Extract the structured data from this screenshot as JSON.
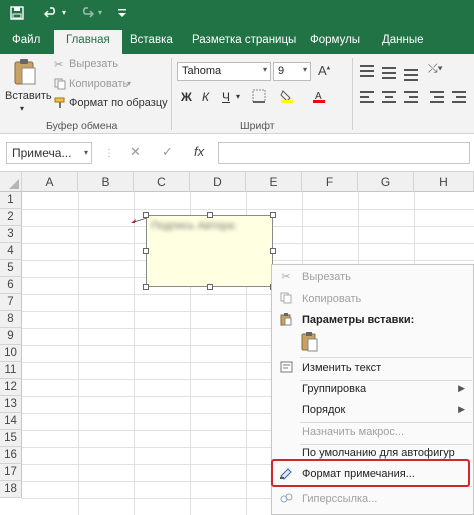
{
  "ribbon_tabs": [
    "Файл",
    "Главная",
    "Вставка",
    "Разметка страницы",
    "Формулы",
    "Данные"
  ],
  "active_tab": "Главная",
  "clipboard": {
    "paste": "Вставить",
    "cut": "Вырезать",
    "copy": "Копировать",
    "format_painter": "Формат по образцу",
    "group_label": "Буфер обмена"
  },
  "font": {
    "name": "Tahoma",
    "size": "9",
    "bold": "Ж",
    "italic": "К",
    "underline": "Ч",
    "group_label": "Шрифт"
  },
  "formula_bar": {
    "name_box": "Примеча...",
    "cancel": "✕",
    "enter": "✓",
    "fx": "fx"
  },
  "columns": [
    "A",
    "B",
    "C",
    "D",
    "E",
    "F",
    "G",
    "H"
  ],
  "rows": [
    "1",
    "2",
    "3",
    "4",
    "5",
    "6",
    "7",
    "8",
    "9",
    "10",
    "11",
    "12",
    "13",
    "14",
    "15",
    "16",
    "17",
    "18"
  ],
  "comment": {
    "text": "Подпись Автора:",
    "background": "#ffffe1"
  },
  "context_menu": [
    {
      "label": "Вырезать",
      "icon": "scissors-icon",
      "disabled": true
    },
    {
      "label": "Копировать",
      "icon": "copy-icon",
      "disabled": true
    },
    {
      "label": "Параметры вставки:",
      "icon": "paste-icon",
      "disabled": false,
      "bold": true
    },
    {
      "label": "Изменить текст",
      "icon": "edit-text-icon",
      "disabled": false
    },
    {
      "label": "Группировка",
      "icon": "",
      "disabled": false,
      "submenu": true
    },
    {
      "label": "Порядок",
      "icon": "",
      "disabled": false,
      "submenu": true
    },
    {
      "label": "Назначить макрос...",
      "icon": "",
      "disabled": true
    },
    {
      "label": "По умолчанию для автофигур",
      "icon": "",
      "disabled": false
    },
    {
      "label": "Формат примечания...",
      "icon": "format-comment-icon",
      "disabled": false,
      "highlighted": true
    },
    {
      "label": "Гиперссылка...",
      "icon": "hyperlink-icon",
      "disabled": true
    }
  ],
  "colors": {
    "excel_green": "#217346",
    "highlight_border": "#d0262c"
  }
}
